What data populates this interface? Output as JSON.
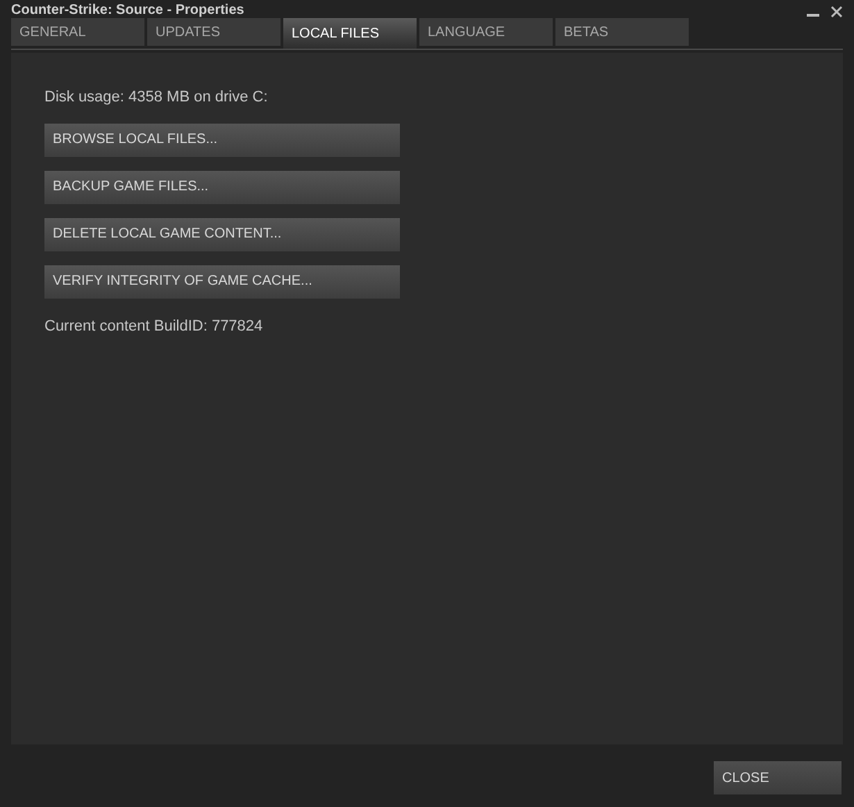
{
  "window": {
    "title": "Counter-Strike: Source - Properties"
  },
  "tabs": [
    {
      "label": "GENERAL",
      "selected": false
    },
    {
      "label": "UPDATES",
      "selected": false
    },
    {
      "label": "LOCAL FILES",
      "selected": true
    },
    {
      "label": "LANGUAGE",
      "selected": false
    },
    {
      "label": "BETAS",
      "selected": false
    }
  ],
  "disk_usage": "Disk usage: 4358 MB on drive C:",
  "buttons": [
    "BROWSE LOCAL FILES...",
    "BACKUP GAME FILES...",
    "DELETE LOCAL GAME CONTENT...",
    "VERIFY INTEGRITY OF GAME CACHE..."
  ],
  "build_id": "Current content BuildID: 777824",
  "close_button": "CLOSE"
}
